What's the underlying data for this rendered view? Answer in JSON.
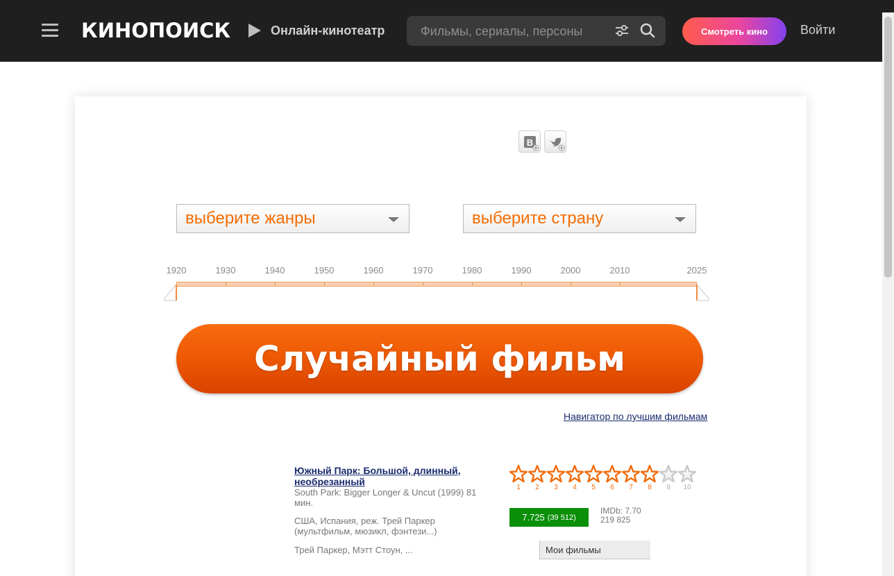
{
  "header": {
    "logo": "КИНОПОИСК",
    "online_cinema": "Онлайн-кинотеатр",
    "search_placeholder": "Фильмы, сериалы, персоны",
    "watch_button": "Смотреть кино",
    "login": "Войти"
  },
  "filters": {
    "genre_placeholder": "выберите жанры",
    "country_placeholder": "выберите страну"
  },
  "years": {
    "labels": [
      "1920",
      "1930",
      "1940",
      "1950",
      "1960",
      "1970",
      "1980",
      "1990",
      "2000",
      "2010",
      "2025"
    ],
    "range": [
      1920,
      2025
    ]
  },
  "random_button": "Случайный фильм",
  "navigator_link": "Навигатор по лучшим фильмам",
  "film": {
    "title": "Южный Парк: Большой, длинный, необрезанный",
    "original": "South Park: Bigger Longer & Uncut (1999) 81 мин.",
    "info": "США, Испания, реж. Трей Паркер (мультфильм, мюзикл, фэнтези...)",
    "cast": "Трей Паркер, Мэтт Стоун, ...",
    "stars": [
      "1",
      "2",
      "3",
      "4",
      "5",
      "6",
      "7",
      "8",
      "9",
      "10"
    ],
    "stars_filled": 8,
    "kp_rating": "7.725",
    "kp_votes": "(39 512)",
    "imdb": "IMDb: 7.70",
    "imdb_votes": "219 825",
    "my_films": "Мои фильмы"
  },
  "colors": {
    "header_bg": "#1f1f1f",
    "accent_orange": "#f56c00",
    "rating_green": "#0a8f08",
    "link": "#1a2b6e"
  }
}
